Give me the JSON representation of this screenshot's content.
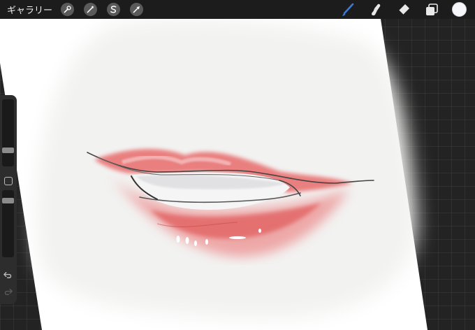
{
  "toolbar": {
    "gallery_label": "ギャラリー",
    "left_tools": [
      {
        "name": "actions",
        "icon": "wrench-icon"
      },
      {
        "name": "adjustments",
        "icon": "magic-wand-icon"
      },
      {
        "name": "selection",
        "icon": "selection-s-icon"
      },
      {
        "name": "transform",
        "icon": "arrow-cursor-icon"
      }
    ],
    "right_tools": [
      {
        "name": "brush",
        "icon": "brush-icon",
        "active": true
      },
      {
        "name": "smudge",
        "icon": "smudge-finger-icon",
        "active": false
      },
      {
        "name": "eraser",
        "icon": "eraser-icon",
        "active": false
      },
      {
        "name": "layers",
        "icon": "layers-icon",
        "active": false
      }
    ],
    "current_color": "#f5f7fa",
    "active_tool_color": "#3a7bd5"
  },
  "sidebar": {
    "brush_size_level": 0.22,
    "opacity_level": 0.5,
    "undo_icon": "undo-icon",
    "redo_icon": "redo-icon",
    "modify_icon": "square-icon"
  },
  "artwork": {
    "subject": "lips-sketch",
    "lip_color": "#e25a5a",
    "paper_color": "#f3f3f2"
  }
}
